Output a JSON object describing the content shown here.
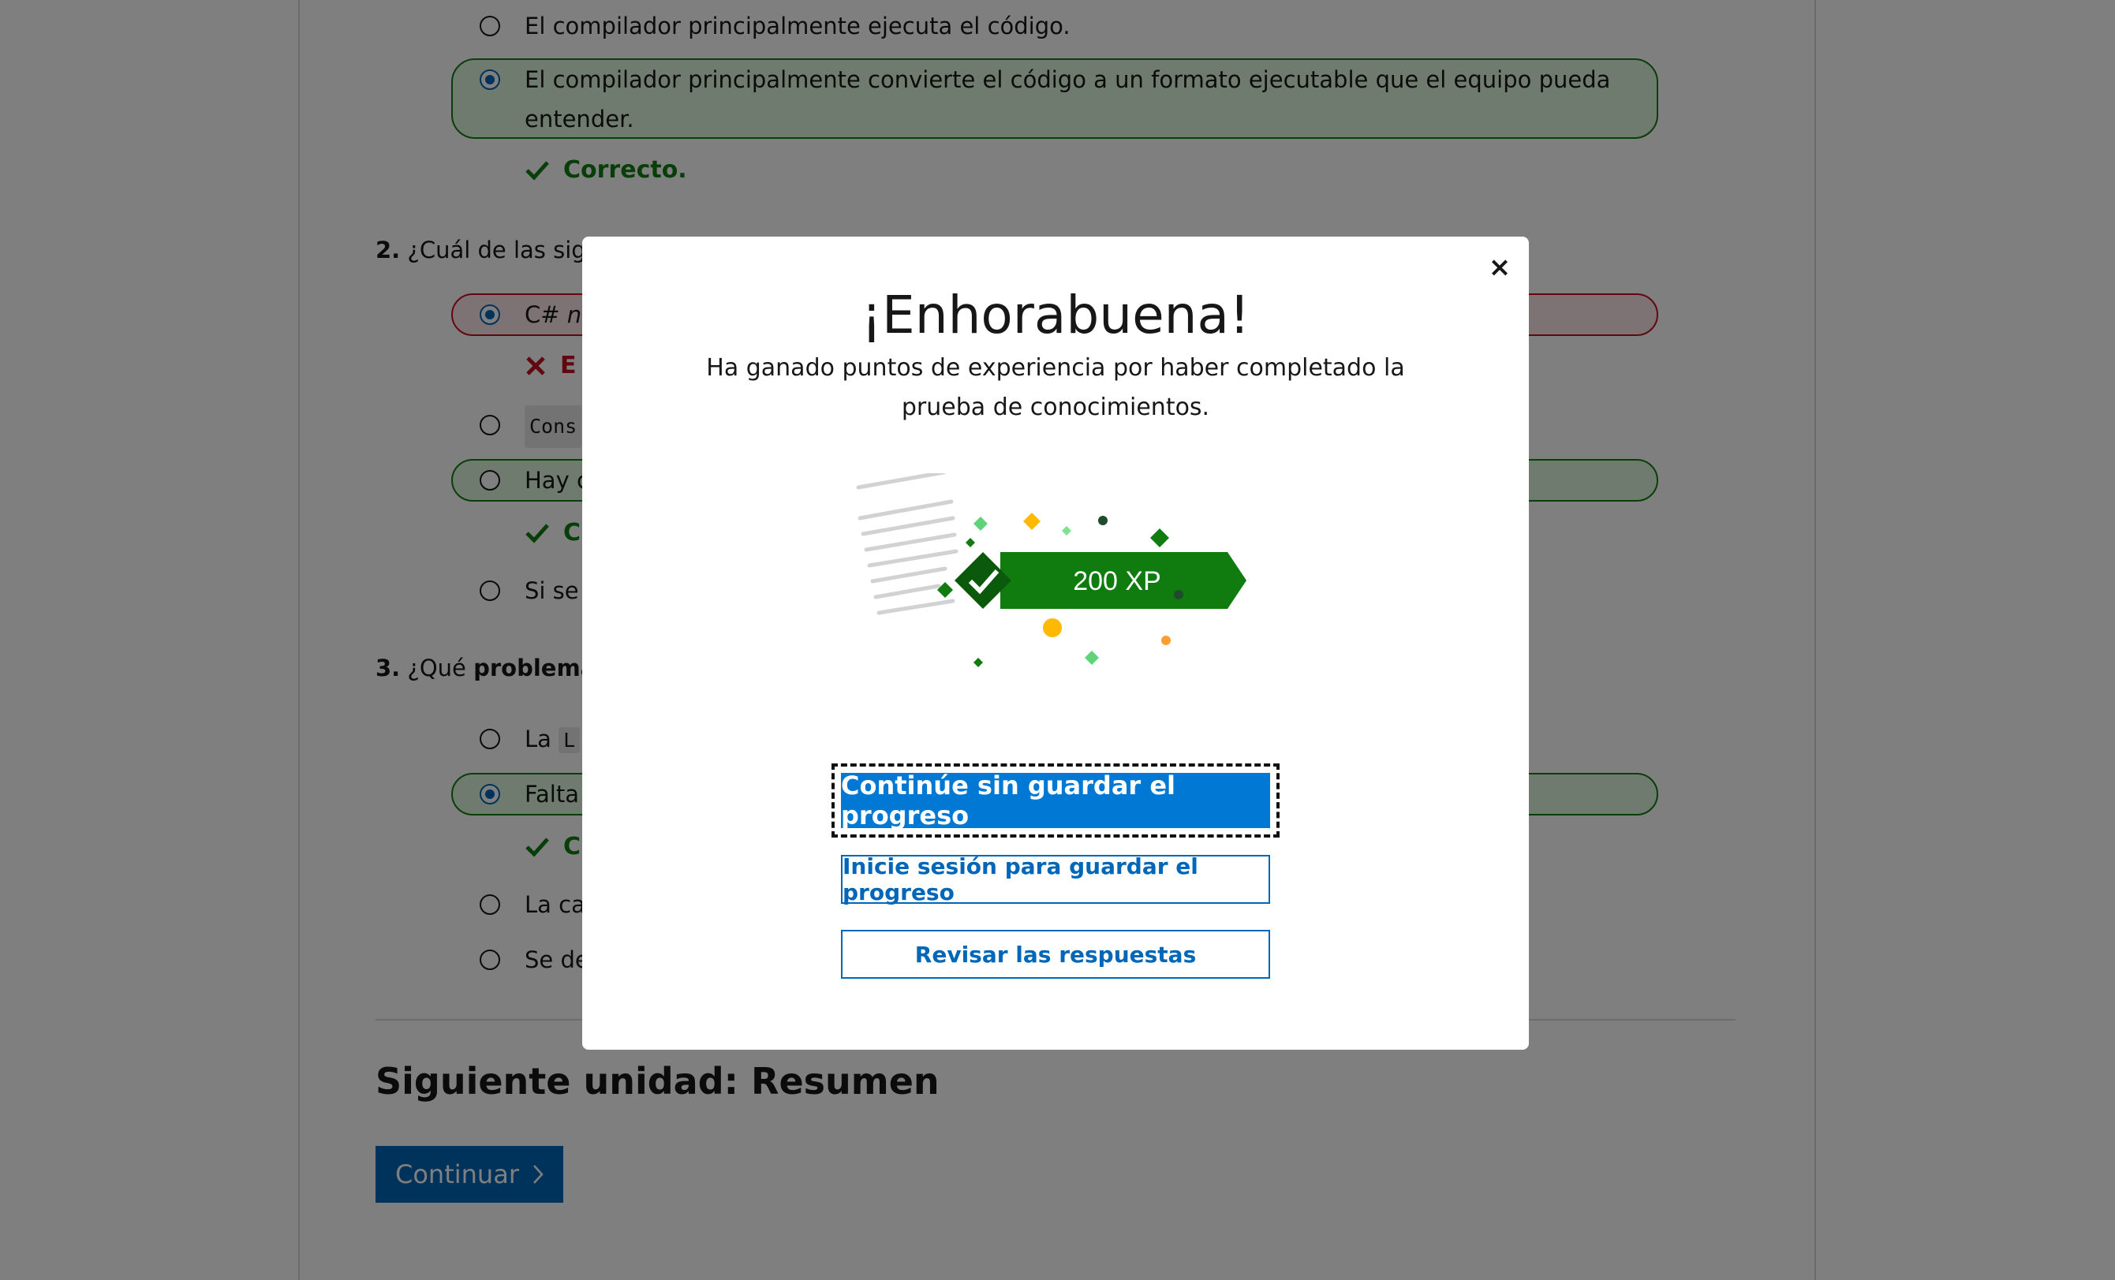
{
  "question1": {
    "option_exec": "El compilador principalmente ejecuta el código.",
    "option_convert": "El compilador principalmente convierte el código a un formato ejecutable que el equipo pueda entender.",
    "feedback": "Correcto."
  },
  "question2": {
    "number": "2.",
    "title": "¿Cuál de las sigu",
    "option_a_prefix": "C#",
    "option_a_rest": "n",
    "feedback_wrong": "E",
    "option_b_code": "Cons",
    "option_c": "Hay c",
    "feedback_ok": "C",
    "option_d": "Si se"
  },
  "question3": {
    "number": "3.",
    "title_pre": "¿Qué",
    "title_bold": "problema",
    "option_a_pre": "La",
    "option_a_code": "L",
    "option_b": "Falta",
    "feedback_ok": "C",
    "option_c": "La ca",
    "option_d": "Se de"
  },
  "next_unit": {
    "title": "Siguiente unidad: Resumen",
    "continue_label": "Continuar"
  },
  "modal": {
    "close": "×",
    "title": "¡Enhorabuena!",
    "message": "Ha ganado puntos de experiencia por haber completado la prueba de conocimientos.",
    "xp_badge": "200 XP",
    "primary_button": "Continúe sin guardar el progreso",
    "signin_button": "Inicie sesión para guardar el progreso",
    "review_button": "Revisar las respuestas"
  },
  "colors": {
    "accent": "#0078d4",
    "success": "#107c10",
    "error": "#c50f1f",
    "gold": "#ffb900"
  },
  "icons": [
    "close-icon",
    "check-icon",
    "cross-icon",
    "chevron-right-icon",
    "xp-badge-illustration"
  ]
}
